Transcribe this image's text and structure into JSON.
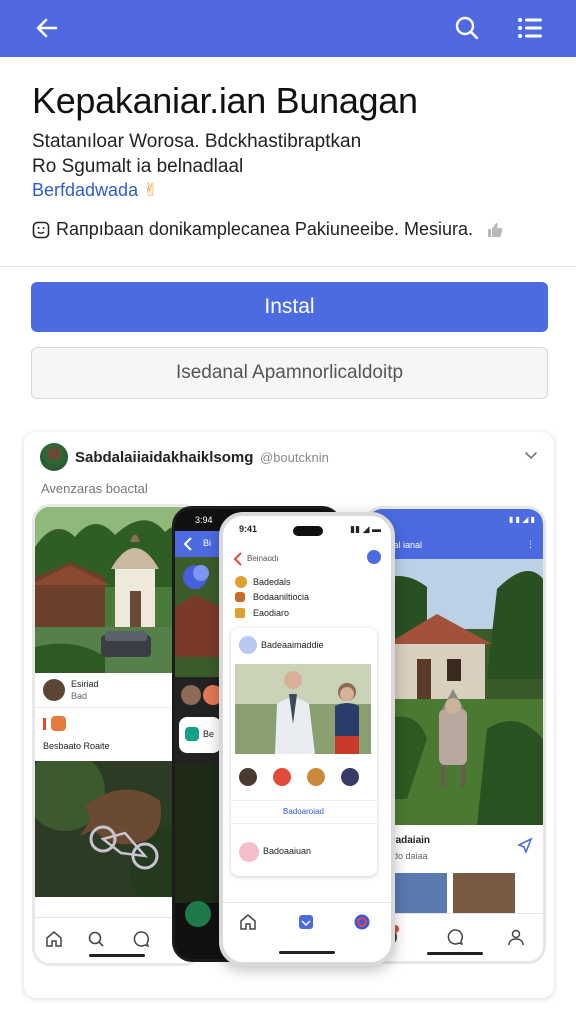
{
  "header": {
    "back_icon": "arrow-left-icon",
    "search_icon": "search-icon",
    "menu_icon": "menu-icon",
    "color": "#5069e0"
  },
  "app": {
    "title": "Kepakaniar.ian Bunagan",
    "subtitle_line1": "Statanıloar Worosa. Bdckhastibraptkan",
    "subtitle_line2": "Ro Sgumalt ia belnadlaal",
    "developer": "Berfdadwada",
    "feature_text": "Rапрıbaan donikamplecanea Pakiuneeibe. Mesiura."
  },
  "buttons": {
    "install_label": "Instal",
    "secondary_label": "Isedanal Apamnorlicaldoitp",
    "accent": "#4c6be0"
  },
  "preview": {
    "user_name": "Sabdalaiiaidakhaiklsomg",
    "handle": "@boutcknin",
    "caption": "Avenzaras boactal",
    "left_screen": {
      "row1_name": "Esiriad",
      "row1_sub": "Bad",
      "row2_label": "Besbaato Roaite"
    },
    "dark_screen": {
      "header_letter": "Bi",
      "row_letter": "Be"
    },
    "center_screen": {
      "time": "9:41",
      "back_label": "Beinaodı",
      "list": [
        "Badedals",
        "Bodaaniltiocia",
        "Eaodiaro"
      ],
      "post_title": "Badeaaimaddie",
      "reaction_bar": "Badoaroiad",
      "footer_label": "Badoaaiuan"
    },
    "right_screen": {
      "header_title": "Dal ianal",
      "caption_title": "Araradaiain",
      "caption_sub": "Aibado daiaa"
    },
    "dark_time": "3:94"
  }
}
